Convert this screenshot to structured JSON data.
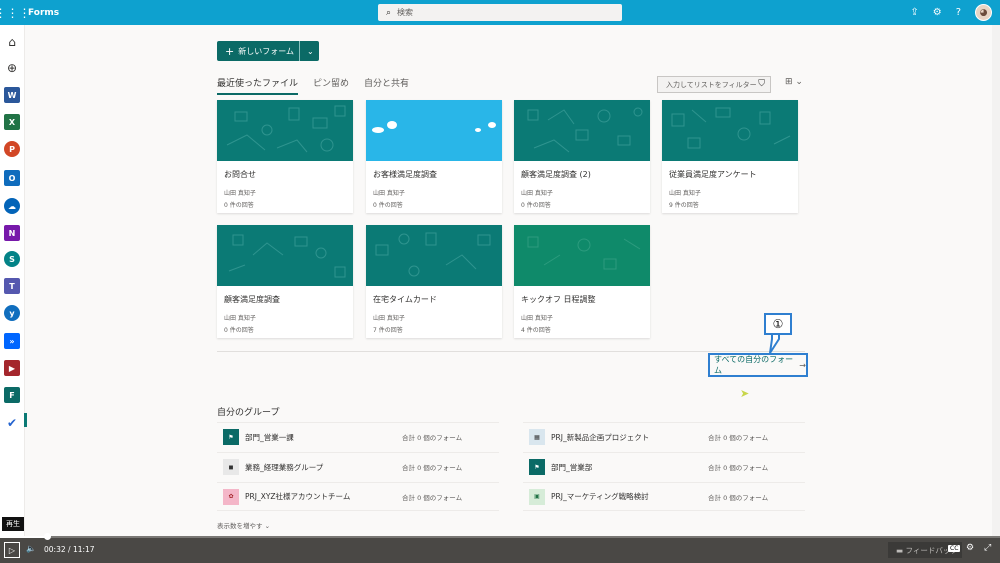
{
  "topbar": {
    "app_name": "Forms",
    "search_placeholder": "検索",
    "icons": [
      "waffle-icon",
      "search-icon",
      "share-icon",
      "gear-icon",
      "help-icon",
      "avatar"
    ]
  },
  "rail": {
    "items": [
      "home-icon",
      "create-icon",
      "word-icon",
      "excel-icon",
      "powerpoint-icon",
      "outlook-icon",
      "onedrive-icon",
      "onenote-icon",
      "sharepoint-icon",
      "teams-icon",
      "yammer-icon",
      "power-automate-icon",
      "power-apps-icon",
      "forms-icon",
      "todo-icon"
    ],
    "colors": {
      "word": "#2b579a",
      "excel": "#217346",
      "powerpoint": "#d24726",
      "outlook": "#0f6cbd",
      "onedrive": "#0364b8",
      "onenote": "#7719aa",
      "sharepoint": "#038387",
      "teams": "#5558af",
      "yammer": "#106ebe",
      "automate": "#0066ff",
      "apps": "#a4262c",
      "forms": "#0b6a66",
      "todo": "#2564cf"
    }
  },
  "toolbar": {
    "new_form_label": "新しいフォーム"
  },
  "tabs": [
    {
      "label": "最近使ったファイル",
      "active": true
    },
    {
      "label": "ピン留め",
      "active": false
    },
    {
      "label": "自分と共有",
      "active": false
    }
  ],
  "filter": {
    "placeholder": "入力してリストをフィルター処理"
  },
  "cards": [
    {
      "title": "お問合せ",
      "owner": "山田 真知子",
      "responses": "0 件の回答",
      "theme": "teal"
    },
    {
      "title": "お客様満足度調査",
      "owner": "山田 真知子",
      "responses": "0 件の回答",
      "theme": "sky"
    },
    {
      "title": "顧客満足度調査 (2)",
      "owner": "山田 真知子",
      "responses": "0 件の回答",
      "theme": "teal"
    },
    {
      "title": "従業員満足度アンケート",
      "owner": "山田 真知子",
      "responses": "9 件の回答",
      "theme": "teal"
    },
    {
      "title": "顧客満足度調査",
      "owner": "山田 真知子",
      "responses": "0 件の回答",
      "theme": "teal"
    },
    {
      "title": "在宅タイムカード",
      "owner": "山田 真知子",
      "responses": "7 件の回答",
      "theme": "teal"
    },
    {
      "title": "キックオフ 日程調整",
      "owner": "山田 真知子",
      "responses": "4 件の回答",
      "theme": "green"
    }
  ],
  "all_forms_link": "すべての自分のフォーム",
  "callout_number": "①",
  "groups": {
    "title": "自分のグループ",
    "items": [
      {
        "name": "部門_営業一課",
        "count": "合計 0 個のフォーム"
      },
      {
        "name": "PRJ_新製品企画プロジェクト",
        "count": "合計 0 個のフォーム"
      },
      {
        "name": "業務_経理業務グループ",
        "count": "合計 0 個のフォーム"
      },
      {
        "name": "部門_営業部",
        "count": "合計 0 個のフォーム"
      },
      {
        "name": "PRJ_XYZ社様アカウントチーム",
        "count": "合計 0 個のフォーム"
      },
      {
        "name": "PRJ_マーケティング戦略検討",
        "count": "合計 0 個のフォーム"
      }
    ],
    "show_more": "表示数を増やす"
  },
  "player": {
    "tooltip": "再生",
    "current_time": "00:32",
    "separator": "/",
    "total_time": "11:17",
    "progress": 0.047,
    "feedback_label": "フィードバック",
    "cc_label": "CC"
  },
  "colors": {
    "accent": "#0b6a66",
    "topbar": "#0ea1cf",
    "callout": "#2f7fd0"
  }
}
